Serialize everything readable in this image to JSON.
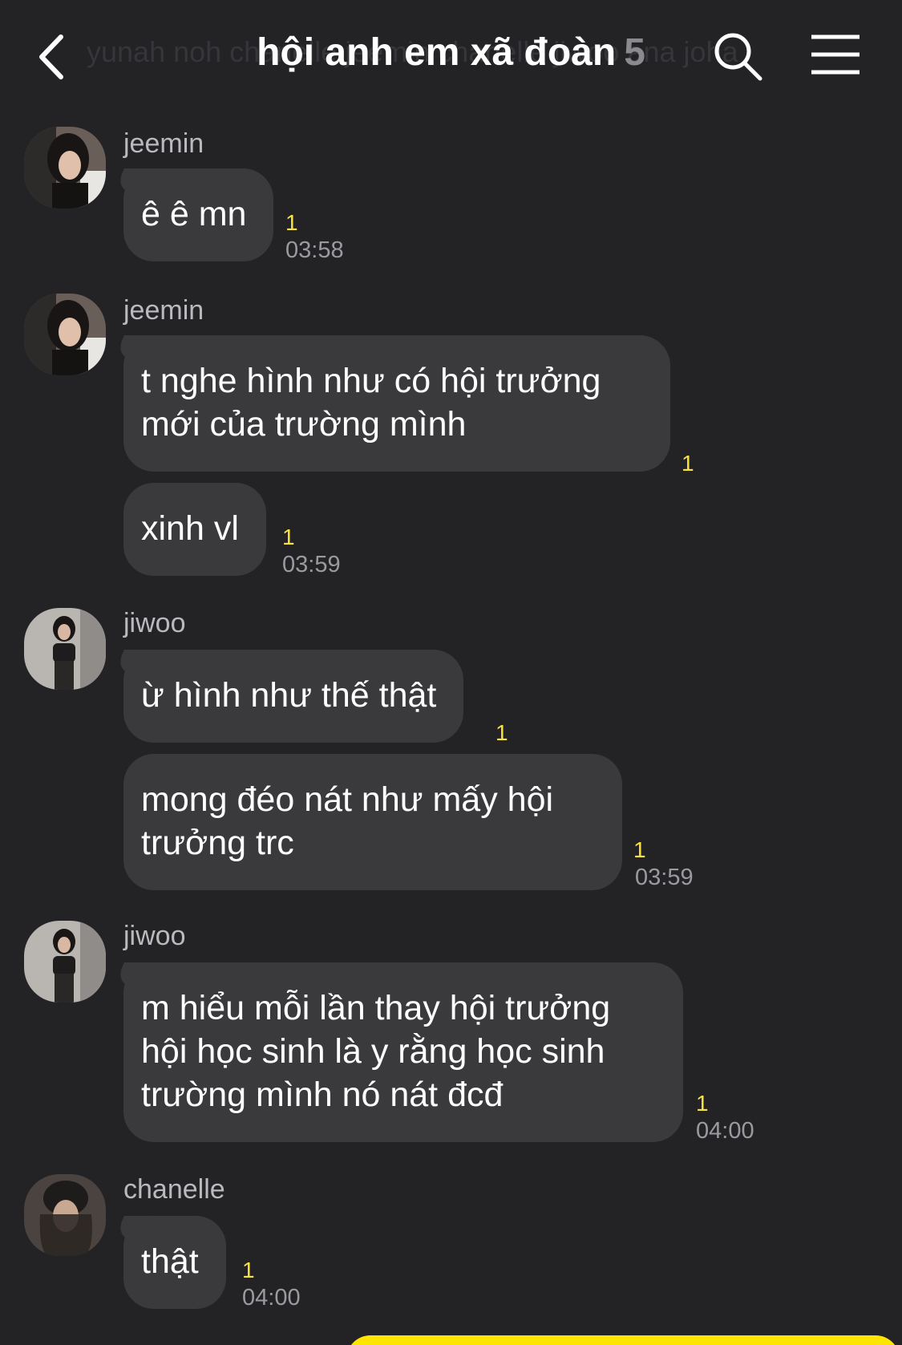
{
  "header": {
    "ghost_text": "yunah noh   chanelle   jeemin   chanelle   jiwoo   ana   joha",
    "title": "hội anh em xã đoàn",
    "member_count": "5"
  },
  "messages": [
    {
      "sender": "jeemin",
      "text": "ê ê mn",
      "unread": "1",
      "time": "03:58"
    },
    {
      "sender": "jeemin",
      "text": "t nghe hình như có hội trưởng mới của trường mình",
      "unread": "1"
    },
    {
      "text": "xinh vl",
      "unread": "1",
      "time": "03:59"
    },
    {
      "sender": "jiwoo",
      "text": "ừ hình như thế thật",
      "unread": "1"
    },
    {
      "text": "mong đéo nát như mấy hội trưởng trc",
      "unread": "1",
      "time": "03:59"
    },
    {
      "sender": "jiwoo",
      "text": "m hiểu mỗi lần thay hội trưởng hội học sinh là y rằng học sinh trường mình nó nát đcđ",
      "unread": "1",
      "time": "04:00"
    },
    {
      "sender": "chanelle",
      "text": "thật",
      "unread": "1",
      "time": "04:00"
    }
  ],
  "colors": {
    "background": "#232326",
    "bubble": "#3a3a3d",
    "unread": "#f8e141",
    "outgoing": "#fee500"
  },
  "icons": [
    "back-arrow-icon",
    "search-icon",
    "menu-icon"
  ]
}
